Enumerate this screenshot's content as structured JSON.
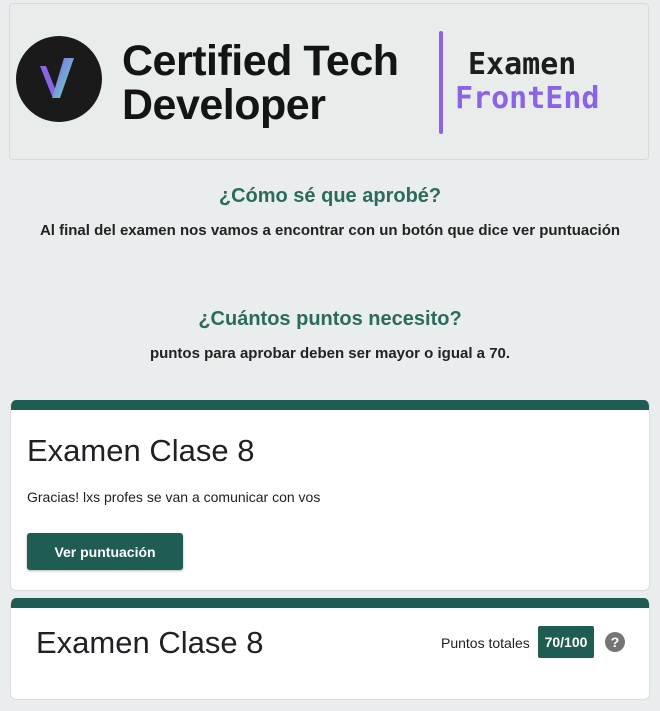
{
  "banner": {
    "brand_line1": "Certified Tech",
    "brand_line2": "Developer",
    "exam_word": "Examen",
    "frontend_word": "FrontEnd",
    "logo_icon": "v-logo-icon",
    "accent_color": "#8b63e6"
  },
  "faq": [
    {
      "question": "¿Cómo sé que aprobé?",
      "answer": "Al final del examen nos vamos a encontrar con un botón que dice ver puntuación"
    },
    {
      "question": "¿Cuántos puntos necesito?",
      "answer": "puntos para aprobar deben ser mayor o igual a 70."
    }
  ],
  "card1": {
    "title": "Examen Clase 8",
    "message": "Gracias! lxs profes se van a comunicar con vos",
    "button_label": "Ver puntuación"
  },
  "card2": {
    "title": "Examen Clase 8",
    "points_label": "Puntos totales",
    "points_value": "70/100",
    "help_icon": "?",
    "help_icon_name": "help-icon"
  },
  "colors": {
    "theme": "#1f5c52",
    "heading": "#2d6a5e",
    "background": "#eaeded"
  }
}
